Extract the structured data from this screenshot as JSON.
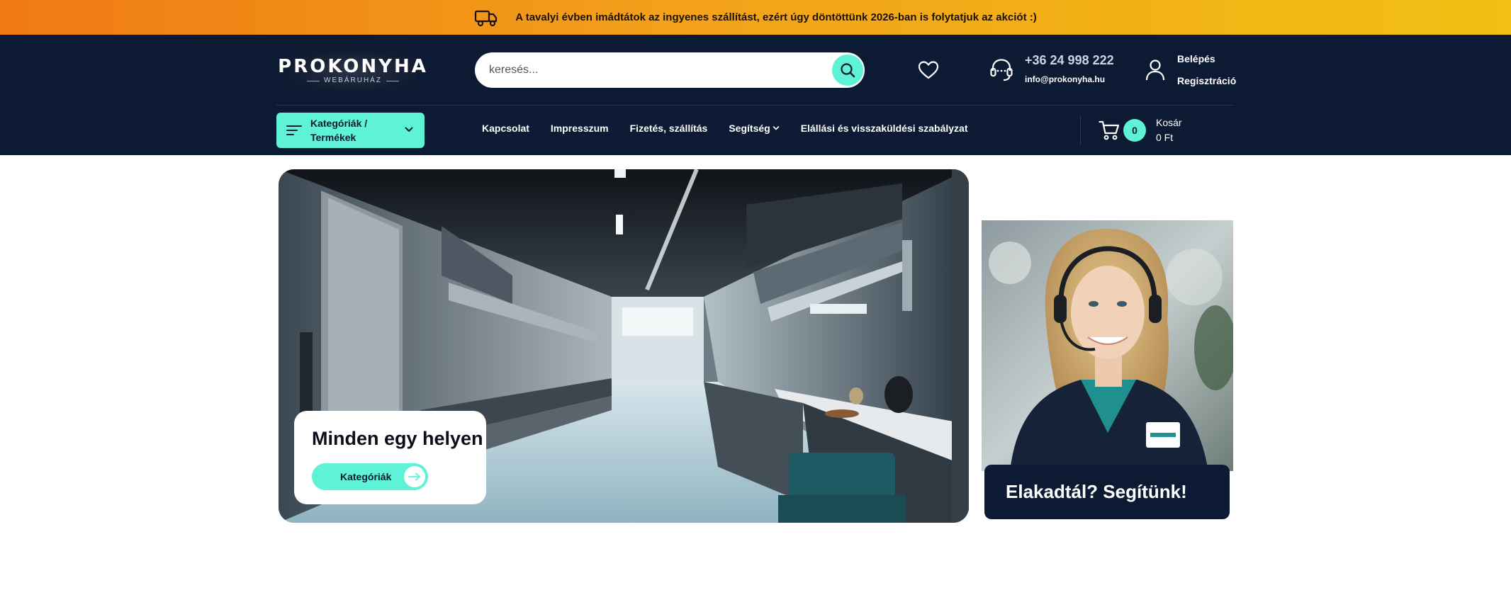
{
  "promo": {
    "icon": "truck-icon",
    "text": "A tavalyi évben imádtátok az ingyenes szállítást, ezért úgy döntöttünk 2026-ban is folytatjuk az akciót :)"
  },
  "header": {
    "logo_main": "PROKONYHA",
    "logo_sub": "WEBÁRUHÁZ",
    "search_placeholder": "keresés...",
    "phone": "+36 24 998 222",
    "email": "info@prokonyha.hu",
    "login": "Belépés",
    "register": "Regisztráció"
  },
  "nav": {
    "categories_button": "Kategóriák / Termékek",
    "items": [
      "Kapcsolat",
      "Impresszum",
      "Fizetés, szállítás",
      "Segítség",
      "Elállási és visszaküldési szabályzat"
    ],
    "cart_count": "0",
    "cart_label": "Kosár",
    "cart_total": "0 Ft"
  },
  "hero": {
    "title": "Minden egy helyen",
    "button": "Kategóriák"
  },
  "support": {
    "title": "Elakadtál? Segítünk!"
  },
  "colors": {
    "accent": "#5ef2d6",
    "navy": "#0d1a33",
    "promo_start": "#f07a14",
    "promo_end": "#f1c013"
  }
}
